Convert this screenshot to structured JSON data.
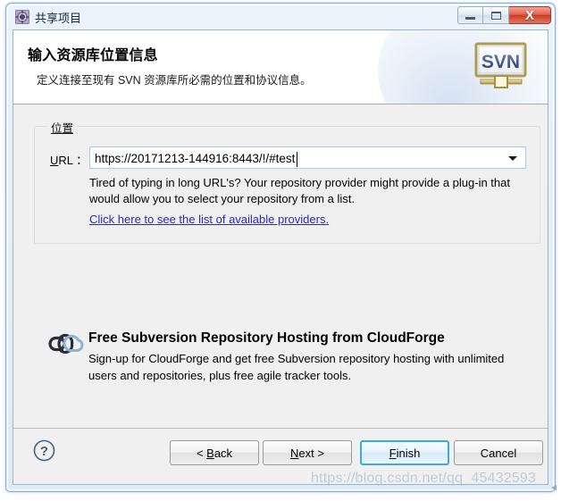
{
  "window": {
    "title": "共享项目",
    "icon": "gear-icon",
    "controls": {
      "minimize": "minimize-icon",
      "maximize": "maximize-icon",
      "close": "X"
    }
  },
  "header": {
    "title": "输入资源库位置信息",
    "subtitle": "定义连接至现有 SVN 资源库所必需的位置和协议信息。",
    "logo_text": "SVN",
    "logo_name": "svn-logo"
  },
  "location_group": {
    "legend": "位置",
    "url_label_prefix": "U",
    "url_label_rest": "RL：",
    "url_label_full": "URL :",
    "url_value": "https://20171213-144916:8443/!/#test",
    "url_placeholder": "",
    "hint_text": "Tired of typing in long URL's?  Your repository provider might provide a plug-in that would allow you to select your repository from a list.",
    "link_text": "Click here to see the list of available providers.",
    "link_color": "#2929c9"
  },
  "promo": {
    "logo_name": "cloudforge-logo",
    "title": "Free Subversion Repository Hosting from CloudForge",
    "body": "Sign-up for CloudForge and get free Subversion repository hosting with unlimited users and repositories, plus free agile tracker tools."
  },
  "buttons": {
    "help": "?",
    "back": {
      "pre": "< ",
      "key": "B",
      "post": "ack"
    },
    "next": {
      "pre": "",
      "key": "N",
      "post": "ext >"
    },
    "finish": {
      "pre": "",
      "key": "F",
      "post": "inish"
    },
    "cancel": {
      "pre": "",
      "key": "",
      "post": "Cancel"
    }
  },
  "watermark": {
    "text": "https://blog.csdn.net/qq_45432593"
  },
  "colors": {
    "accent": "#3ea8e0",
    "link": "#2929c9",
    "titlebar_close": "#cc3d23",
    "dialog_bg": "#f0f0f0"
  }
}
